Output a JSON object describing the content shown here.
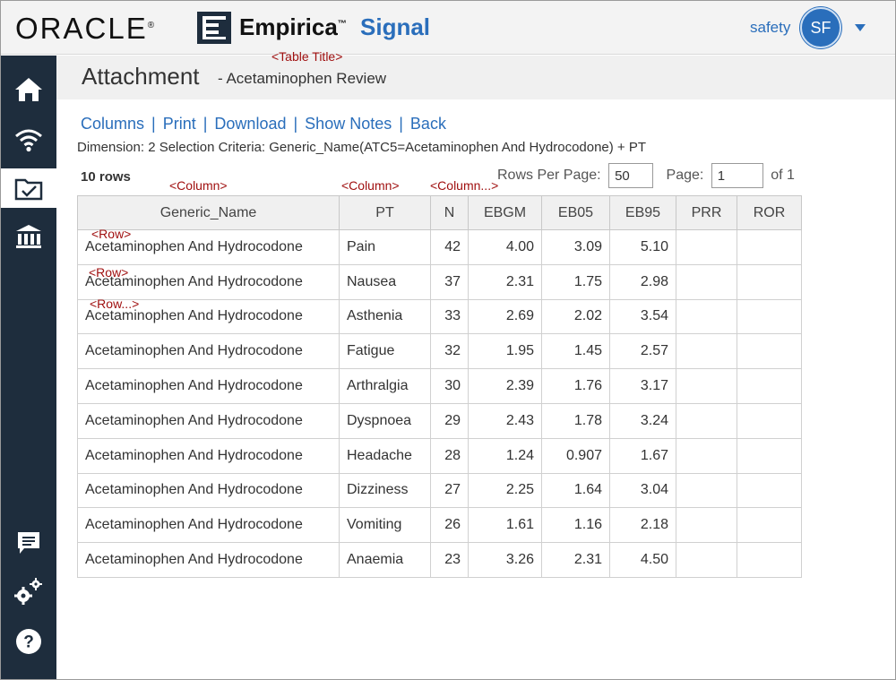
{
  "header": {
    "brand_oracle": "ORACLE",
    "brand_reg": "®",
    "brand_product": "Empirica",
    "brand_tm": "™",
    "brand_signal": "Signal",
    "user_name": "safety",
    "user_initials": "SF"
  },
  "sidebar": {
    "items": [
      {
        "icon": "home-icon"
      },
      {
        "icon": "wifi-signal-icon"
      },
      {
        "icon": "folder-check-icon",
        "active": true
      },
      {
        "icon": "bank-chart-icon"
      },
      {
        "icon": "comment-icon"
      },
      {
        "icon": "gears-icon"
      },
      {
        "icon": "help-icon"
      }
    ]
  },
  "title": {
    "main": "Attachment",
    "subtitle": "- Acetaminophen Review"
  },
  "annotations": {
    "table_title": "<Table Title>",
    "column_1": "<Column>",
    "column_2": "<Column>",
    "column_3": "<Column...>",
    "row_1": "<Row>",
    "row_2": "<Row>",
    "row_3": "<Row...>"
  },
  "toolbar": {
    "columns": "Columns",
    "print": "Print",
    "download": "Download",
    "show_notes": "Show Notes",
    "back": "Back",
    "separator": "|"
  },
  "criteria": "Dimension: 2 Selection Criteria: Generic_Name(ATC5=Acetaminophen And Hydrocodone) + PT",
  "row_count": "10 rows",
  "pager": {
    "rows_per_page_label": "Rows Per Page:",
    "rows_per_page": "50",
    "page_label": "Page:",
    "page": "1",
    "of_label": "of 1"
  },
  "table": {
    "headers": [
      "Generic_Name",
      "PT",
      "N",
      "EBGM",
      "EB05",
      "EB95",
      "PRR",
      "ROR"
    ],
    "rows": [
      [
        "Acetaminophen And Hydrocodone",
        "Pain",
        "42",
        "4.00",
        "3.09",
        "5.10",
        "",
        ""
      ],
      [
        "Acetaminophen And Hydrocodone",
        "Nausea",
        "37",
        "2.31",
        "1.75",
        "2.98",
        "",
        ""
      ],
      [
        "Acetaminophen And Hydrocodone",
        "Asthenia",
        "33",
        "2.69",
        "2.02",
        "3.54",
        "",
        ""
      ],
      [
        "Acetaminophen And Hydrocodone",
        "Fatigue",
        "32",
        "1.95",
        "1.45",
        "2.57",
        "",
        ""
      ],
      [
        "Acetaminophen And Hydrocodone",
        "Arthralgia",
        "30",
        "2.39",
        "1.76",
        "3.17",
        "",
        ""
      ],
      [
        "Acetaminophen And Hydrocodone",
        "Dyspnoea",
        "29",
        "2.43",
        "1.78",
        "3.24",
        "",
        ""
      ],
      [
        "Acetaminophen And Hydrocodone",
        "Headache",
        "28",
        "1.24",
        "0.907",
        "1.67",
        "",
        ""
      ],
      [
        "Acetaminophen And Hydrocodone",
        "Dizziness",
        "27",
        "2.25",
        "1.64",
        "3.04",
        "",
        ""
      ],
      [
        "Acetaminophen And Hydrocodone",
        "Vomiting",
        "26",
        "1.61",
        "1.16",
        "2.18",
        "",
        ""
      ],
      [
        "Acetaminophen And Hydrocodone",
        "Anaemia",
        "23",
        "3.26",
        "2.31",
        "4.50",
        "",
        ""
      ]
    ]
  },
  "colors": {
    "accent": "#2a6ebb",
    "sidebar": "#1e2d3d",
    "annotation": "#a01010"
  }
}
